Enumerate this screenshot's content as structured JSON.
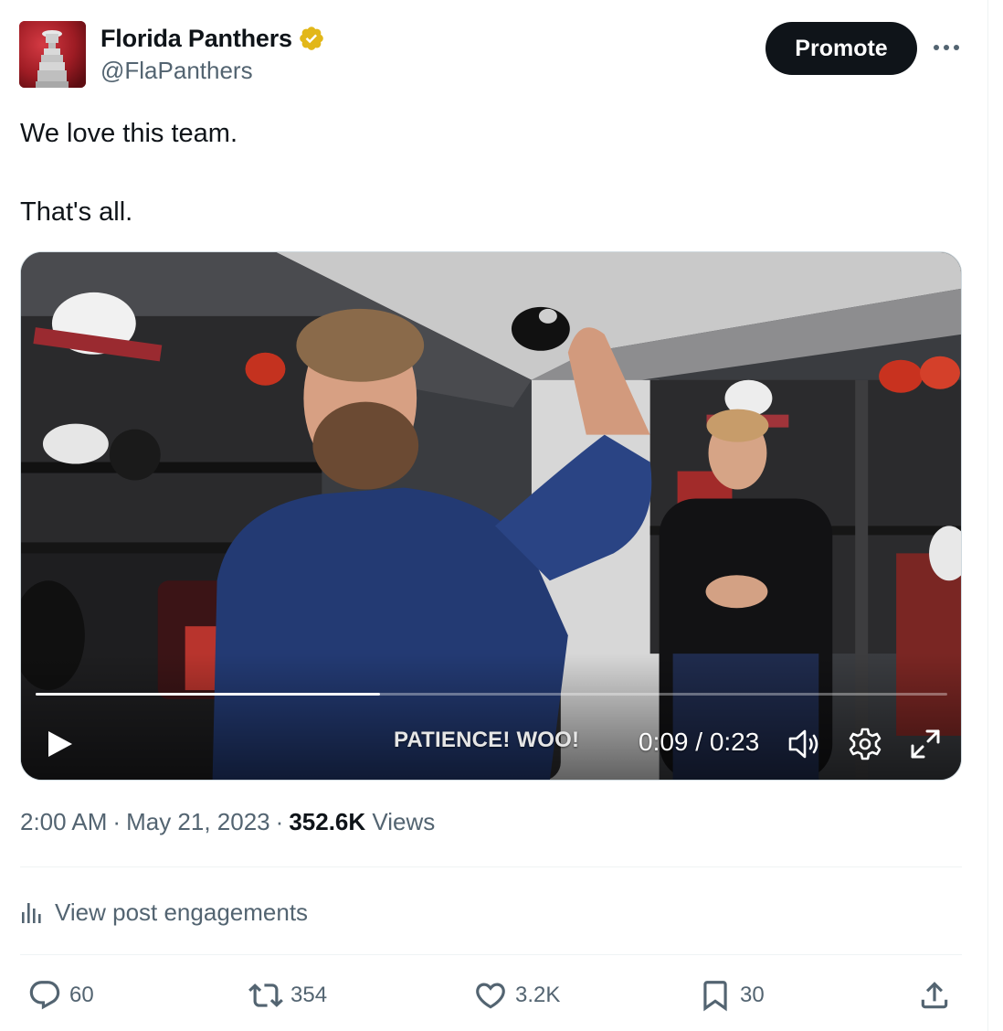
{
  "author": {
    "display_name": "Florida Panthers",
    "handle": "@FlaPanthers",
    "verified": true
  },
  "header": {
    "promote_label": "Promote",
    "more_icon": "more-horizontal-icon"
  },
  "tweet": {
    "lines": [
      "We love this team.",
      "That's all."
    ]
  },
  "video": {
    "caption": "PATIENCE! WOO!",
    "time_display": "0:09 / 0:23",
    "progress": 0.378,
    "play_icon": "play-icon",
    "volume_icon": "volume-icon",
    "settings_icon": "gear-icon",
    "fullscreen_icon": "fullscreen-icon"
  },
  "meta": {
    "time": "2:00 AM",
    "date": "May 21, 2023",
    "views_count": "352.6K",
    "views_label": "Views"
  },
  "engagements": {
    "label": "View post engagements",
    "icon": "bar-chart-icon"
  },
  "actions": {
    "replies": "60",
    "reposts": "354",
    "likes": "3.2K",
    "bookmarks": "30"
  },
  "colors": {
    "text_primary": "#0f1419",
    "text_secondary": "#536471",
    "verified_gold": "#e2b719",
    "border": "#eff3f4"
  }
}
